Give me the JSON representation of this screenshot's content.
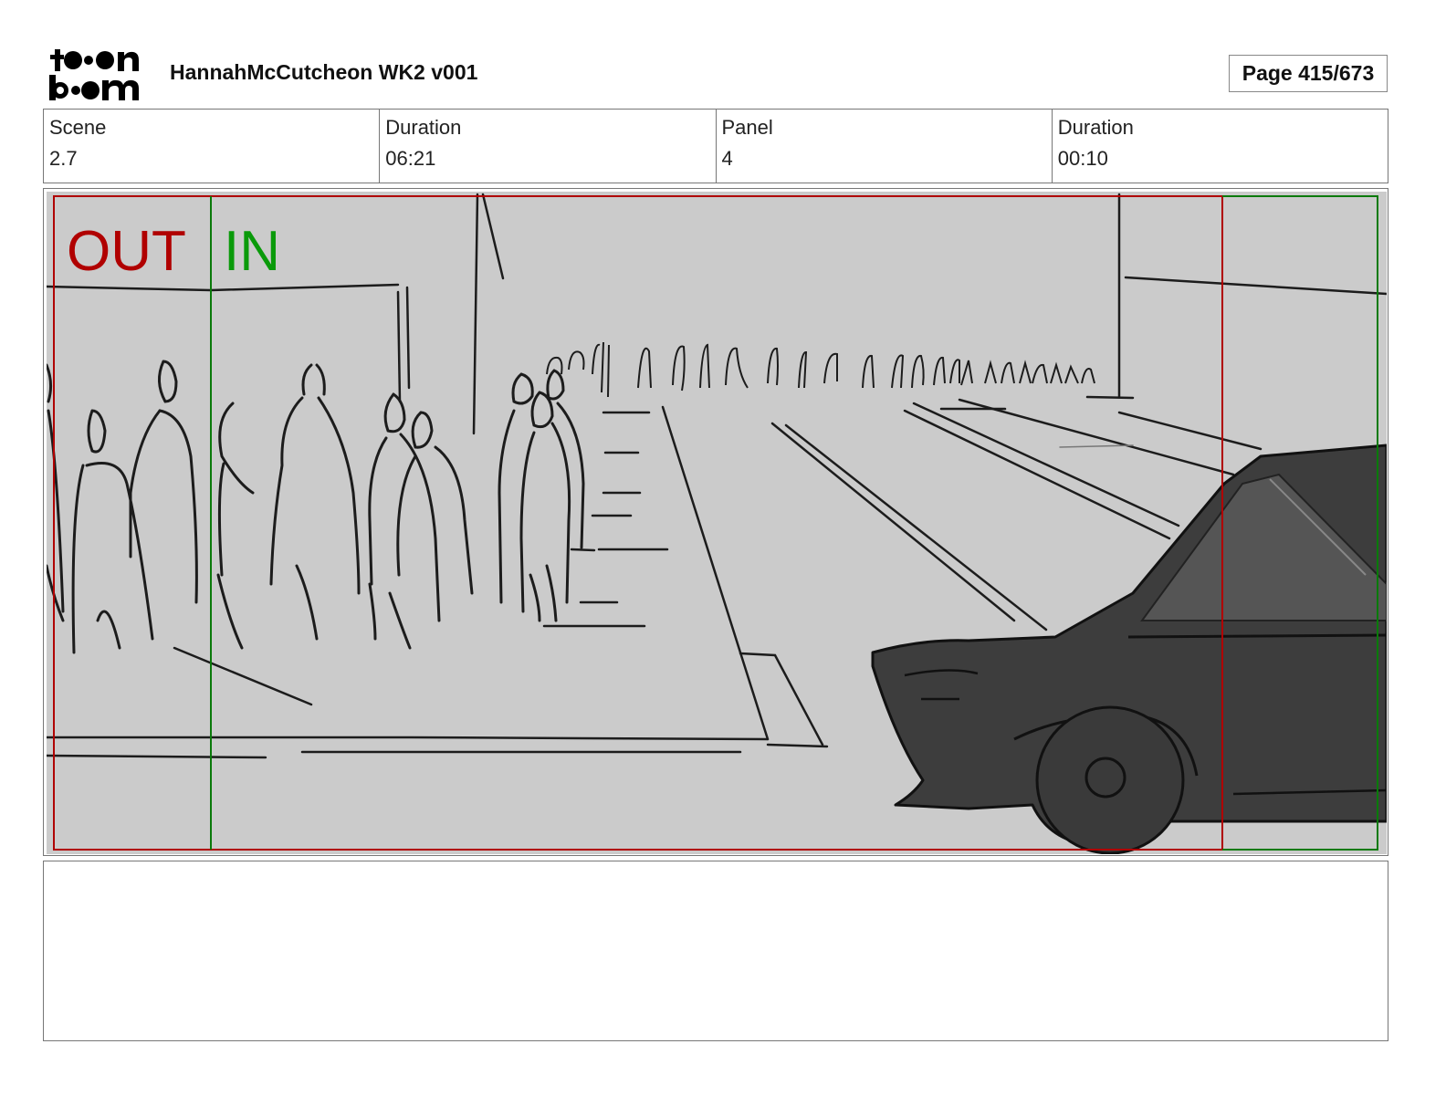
{
  "header": {
    "logo_alt": "toon boom",
    "title": "HannahMcCutcheon WK2 v001",
    "page_label": "Page 415/673"
  },
  "info": {
    "scene_label": "Scene",
    "scene_value": "2.7",
    "scene_duration_label": "Duration",
    "scene_duration_value": "06:21",
    "panel_label": "Panel",
    "panel_value": "4",
    "panel_duration_label": "Duration",
    "panel_duration_value": "00:10"
  },
  "panel": {
    "out_marker": "OUT",
    "in_marker": "IN",
    "colors": {
      "out": "#b00000",
      "in": "#0a9a0a",
      "frame_bg": "#cbcbcb",
      "car": "#3d3d3d"
    }
  },
  "notes": {
    "text": ""
  }
}
